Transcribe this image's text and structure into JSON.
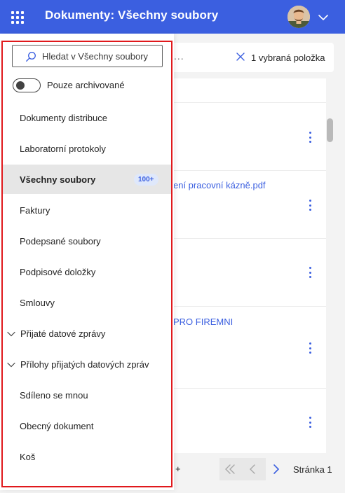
{
  "header": {
    "title": "Dokumenty: Všechny soubory",
    "brand_color": "#3b5fe0",
    "icons": {
      "app_launcher": "waffle-icon",
      "user_menu": "chevron-down-icon"
    }
  },
  "toolbar": {
    "overflow": "...",
    "selection_label": "1 vybraná položka",
    "clear_icon": "close-icon"
  },
  "document_list": {
    "rows": [
      {
        "name": ""
      },
      {
        "name": "ení pracovní kázně.pdf"
      },
      {
        "name": ""
      },
      {
        "name": "PRO FIREMNI"
      },
      {
        "name": ""
      }
    ],
    "link_color": "#3b5fe0"
  },
  "pagination": {
    "add_label": "+",
    "page_label": "Stránka 1"
  },
  "sidebar": {
    "search_placeholder": "Hledat v Všechny soubory",
    "archive_toggle_label": "Pouze archivované",
    "archive_toggle_on": false,
    "highlight_color": "#e0191c",
    "items": [
      {
        "label": "Dokumenty distribuce",
        "expandable": false,
        "active": false
      },
      {
        "label": "Laboratorní protokoly",
        "expandable": false,
        "active": false
      },
      {
        "label": "Všechny soubory",
        "expandable": false,
        "active": true,
        "badge": "100+"
      },
      {
        "label": "Faktury",
        "expandable": false,
        "active": false
      },
      {
        "label": "Podepsané soubory",
        "expandable": false,
        "active": false
      },
      {
        "label": "Podpisové doložky",
        "expandable": false,
        "active": false
      },
      {
        "label": "Smlouvy",
        "expandable": false,
        "active": false
      },
      {
        "label": "Přijaté datové zprávy",
        "expandable": true,
        "active": false
      },
      {
        "label": "Přílohy přijatých datových zpráv",
        "expandable": true,
        "active": false
      },
      {
        "label": "Sdíleno se mnou",
        "expandable": false,
        "active": false
      },
      {
        "label": "Obecný dokument",
        "expandable": false,
        "active": false
      },
      {
        "label": "Koš",
        "expandable": false,
        "active": false
      }
    ]
  }
}
